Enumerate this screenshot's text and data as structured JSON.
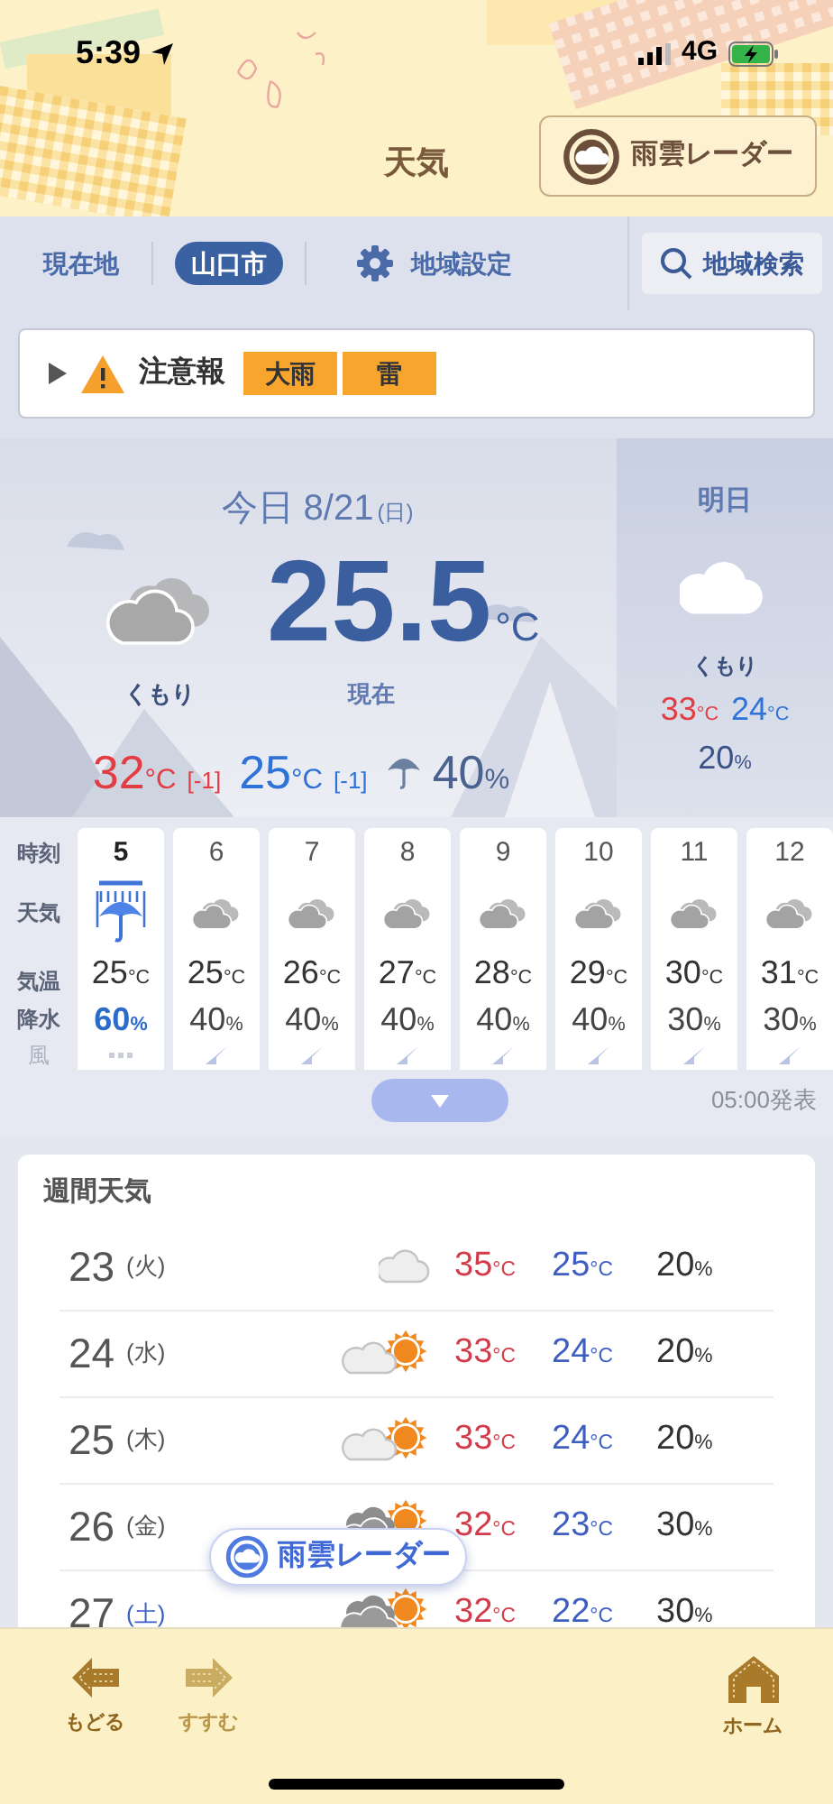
{
  "status_bar": {
    "time": "5:39",
    "network": "4G"
  },
  "header": {
    "title": "天気",
    "radar_button": "雨雲レーダー"
  },
  "location_bar": {
    "tabs": [
      {
        "label": "現在地",
        "selected": false
      },
      {
        "label": "山口市",
        "selected": true
      }
    ],
    "settings": "地域設定",
    "search": "地域検索"
  },
  "alert": {
    "expanded": false,
    "label": "注意報",
    "tags": [
      "大雨",
      "雷"
    ]
  },
  "today": {
    "date": "今日 8/21",
    "weekday": "(日)",
    "weather": "くもり",
    "current_label": "現在",
    "current_temp": "25.5",
    "current_unit": "°C",
    "high": {
      "value": "32",
      "unit": "°C",
      "diff": "[-1]"
    },
    "low": {
      "value": "25",
      "unit": "°C",
      "diff": "[-1]"
    },
    "pop": {
      "value": "40",
      "unit": "%"
    }
  },
  "tomorrow": {
    "label": "明日",
    "weather": "くもり",
    "high": {
      "value": "33",
      "unit": "°C"
    },
    "low": {
      "value": "24",
      "unit": "°C"
    },
    "pop": {
      "value": "20",
      "unit": "%"
    }
  },
  "hourly": {
    "row_labels": [
      "時刻",
      "天気",
      "気温",
      "降水",
      "風"
    ],
    "hours": [
      {
        "hour": "5",
        "current": true,
        "kind": "rain",
        "temp": "25",
        "temp_unit": "°C",
        "pop": "60",
        "pop_unit": "%",
        "wind": {
          "kind": "calm"
        }
      },
      {
        "hour": "6",
        "current": false,
        "kind": "cloudy",
        "temp": "25",
        "temp_unit": "°C",
        "pop": "40",
        "pop_unit": "%",
        "wind": {
          "kind": "arrow"
        }
      },
      {
        "hour": "7",
        "current": false,
        "kind": "cloudy",
        "temp": "26",
        "temp_unit": "°C",
        "pop": "40",
        "pop_unit": "%",
        "wind": {
          "kind": "arrow"
        }
      },
      {
        "hour": "8",
        "current": false,
        "kind": "cloudy",
        "temp": "27",
        "temp_unit": "°C",
        "pop": "40",
        "pop_unit": "%",
        "wind": {
          "kind": "arrow"
        }
      },
      {
        "hour": "9",
        "current": false,
        "kind": "cloudy",
        "temp": "28",
        "temp_unit": "°C",
        "pop": "40",
        "pop_unit": "%",
        "wind": {
          "kind": "arrow"
        }
      },
      {
        "hour": "10",
        "current": false,
        "kind": "cloudy",
        "temp": "29",
        "temp_unit": "°C",
        "pop": "40",
        "pop_unit": "%",
        "wind": {
          "kind": "arrow"
        }
      },
      {
        "hour": "11",
        "current": false,
        "kind": "cloudy",
        "temp": "30",
        "temp_unit": "°C",
        "pop": "30",
        "pop_unit": "%",
        "wind": {
          "kind": "arrow"
        }
      },
      {
        "hour": "12",
        "current": false,
        "kind": "cloudy",
        "temp": "31",
        "temp_unit": "°C",
        "pop": "30",
        "pop_unit": "%",
        "wind": {
          "kind": "arrow"
        }
      }
    ],
    "expanded": false,
    "issued": "05:00発表"
  },
  "weekly": {
    "title": "週間天気",
    "days": [
      {
        "day": "23",
        "weekday": "(火)",
        "color": "#555555",
        "kind": "cloudy",
        "high": "35",
        "high_unit": "°C",
        "low": "25",
        "low_unit": "°C",
        "pop": "20",
        "pop_unit": "%"
      },
      {
        "day": "24",
        "weekday": "(水)",
        "color": "#555555",
        "kind": "partly",
        "high": "33",
        "high_unit": "°C",
        "low": "24",
        "low_unit": "°C",
        "pop": "20",
        "pop_unit": "%"
      },
      {
        "day": "25",
        "weekday": "(木)",
        "color": "#555555",
        "kind": "partly",
        "high": "33",
        "high_unit": "°C",
        "low": "24",
        "low_unit": "°C",
        "pop": "20",
        "pop_unit": "%"
      },
      {
        "day": "26",
        "weekday": "(金)",
        "color": "#555555",
        "kind": "overcast",
        "high": "32",
        "high_unit": "°C",
        "low": "23",
        "low_unit": "°C",
        "pop": "30",
        "pop_unit": "%"
      },
      {
        "day": "27",
        "weekday": "(土)",
        "color": "#3b5fc4",
        "kind": "overcast",
        "high": "32",
        "high_unit": "°C",
        "low": "22",
        "low_unit": "°C",
        "pop": "30",
        "pop_unit": "%"
      }
    ]
  },
  "floating_radar_button": "雨雲レーダー",
  "nav": [
    {
      "label": "もどる",
      "kind": "back",
      "disabled": false
    },
    {
      "label": "すすむ",
      "kind": "forward",
      "disabled": true
    },
    {
      "label": "ホーム",
      "kind": "home",
      "disabled": false
    }
  ]
}
